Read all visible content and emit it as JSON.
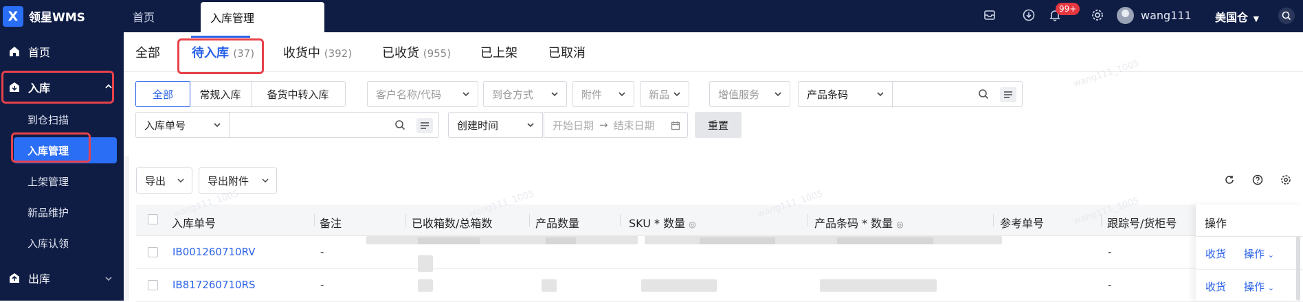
{
  "app": {
    "logo_text": "领星WMS",
    "logo_mark": "X"
  },
  "top_tabs": [
    {
      "label": "首页"
    },
    {
      "label": "入库管理"
    }
  ],
  "topbar": {
    "badge": "99+",
    "username": "wang111",
    "warehouse": "美国仓"
  },
  "sidebar": {
    "home": "首页",
    "inbound": "入库",
    "inbound_sub": [
      "到仓扫描",
      "入库管理",
      "上架管理",
      "新品维护",
      "入库认领"
    ],
    "outbound": "出库"
  },
  "status_tabs": [
    {
      "label": "全部",
      "count": ""
    },
    {
      "label": "待入库",
      "count": "(37)"
    },
    {
      "label": "收货中",
      "count": "(392)"
    },
    {
      "label": "已收货",
      "count": "(955)"
    },
    {
      "label": "已上架",
      "count": ""
    },
    {
      "label": "已取消",
      "count": ""
    }
  ],
  "filters": {
    "type_segments": [
      "全部",
      "常规入库",
      "备货中转入库"
    ],
    "customer": "客户名称/代码",
    "arrival_method": "到仓方式",
    "attachment": "附件",
    "new_product": "新品",
    "value_added": "增值服务",
    "barcode_field": "产品条码",
    "order_no_field": "入库单号",
    "time_field": "创建时间",
    "start_date": "开始日期",
    "end_date": "结束日期",
    "reset": "重置"
  },
  "actions": {
    "export": "导出",
    "export_attachment": "导出附件"
  },
  "table": {
    "columns": [
      "入库单号",
      "备注",
      "已收箱数/总箱数",
      "产品数量",
      "SKU * 数量",
      "产品条码 * 数量",
      "参考单号",
      "跟踪号/货柜号",
      "操作"
    ],
    "rows": [
      {
        "order_no": "IB001260710RV",
        "remark": "-",
        "tracking": "-",
        "op_receive": "收货",
        "op_more": "操作"
      },
      {
        "order_no": "IB817260710RS",
        "remark": "-",
        "tracking": "-",
        "op_receive": "收货",
        "op_more": "操作"
      }
    ]
  },
  "watermark": "wang111_1005",
  "colors": {
    "nav_bg": "#0f1d45",
    "accent": "#2a62e8",
    "highlight": "#e8414a"
  }
}
